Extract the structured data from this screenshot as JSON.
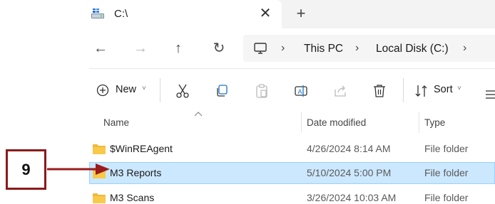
{
  "tab": {
    "title": "C:\\",
    "close_glyph": "✕",
    "new_tab_glyph": "+",
    "icon": "drive-icon"
  },
  "nav": {
    "back": "←",
    "forward": "→",
    "up": "↑",
    "refresh": "↻"
  },
  "address": {
    "crumbs": [
      "This PC",
      "Local Disk (C:)"
    ],
    "separator": "›",
    "icon": "computer-icon"
  },
  "toolbar": {
    "new_label": "New",
    "sort_label": "Sort",
    "caret": "˅",
    "icons": [
      "new-icon",
      "cut-icon",
      "copy-icon",
      "paste-icon",
      "rename-icon",
      "share-icon",
      "delete-icon",
      "sort-icon",
      "view-icon"
    ]
  },
  "columns": {
    "name": "Name",
    "date_modified": "Date modified",
    "type": "Type"
  },
  "rows": [
    {
      "name": "$WinREAgent",
      "date": "4/26/2024 8:14 AM",
      "type": "File folder",
      "selected": false
    },
    {
      "name": "M3 Reports",
      "date": "5/10/2024 5:00 PM",
      "type": "File folder",
      "selected": true
    },
    {
      "name": "M3 Scans",
      "date": "3/26/2024 10:03 AM",
      "type": "File folder",
      "selected": false
    }
  ],
  "callout": {
    "label": "9"
  },
  "colors": {
    "selection": "#cce8ff",
    "selection_border": "#99d1ff",
    "callout_border": "#8b1a1a",
    "arrow": "#9b1c1c",
    "folder": "#f8c94a"
  }
}
